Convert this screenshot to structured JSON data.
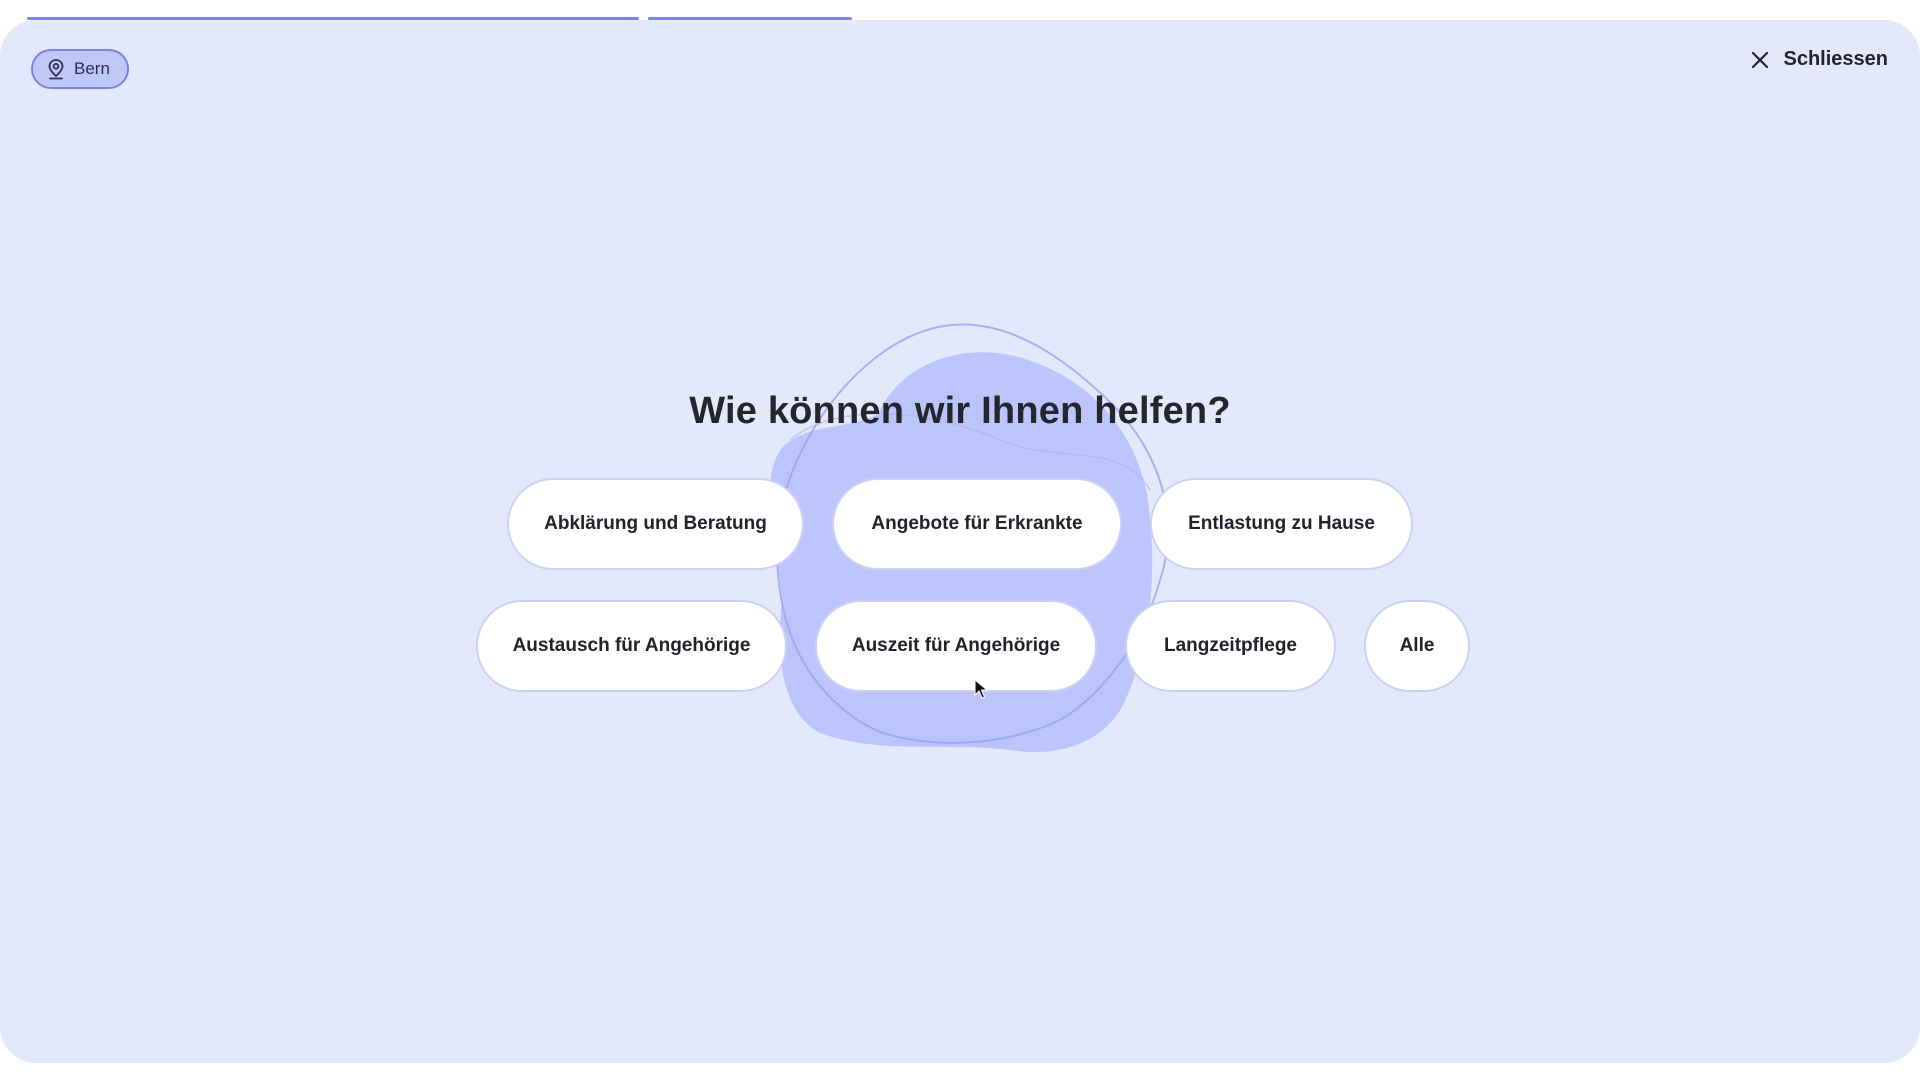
{
  "progress": {
    "segments": [
      {
        "state": "complete"
      },
      {
        "state": "current"
      }
    ],
    "color": "#7f86e0"
  },
  "location": {
    "label": "Bern",
    "icon": "location-pin-icon"
  },
  "close": {
    "label": "Schliessen",
    "icon": "close-icon"
  },
  "heading": "Wie können wir Ihnen helfen?",
  "options": [
    {
      "label": "Abklärung und Beratung"
    },
    {
      "label": "Angebote für Erkrankte"
    },
    {
      "label": "Entlastung zu Hause"
    },
    {
      "label": "Austausch für Angehörige"
    },
    {
      "label": "Auszeit für Angehörige"
    },
    {
      "label": "Langzeitpflege"
    },
    {
      "label": "Alle"
    }
  ],
  "colors": {
    "background": "#e4e8fb",
    "accent": "#7d84dd",
    "chip_fill": "#c1c8f8",
    "blob": "#b7c0fb",
    "pill_fill": "#ffffff",
    "pill_border": "#ccd1f4",
    "text": "#22232a"
  }
}
